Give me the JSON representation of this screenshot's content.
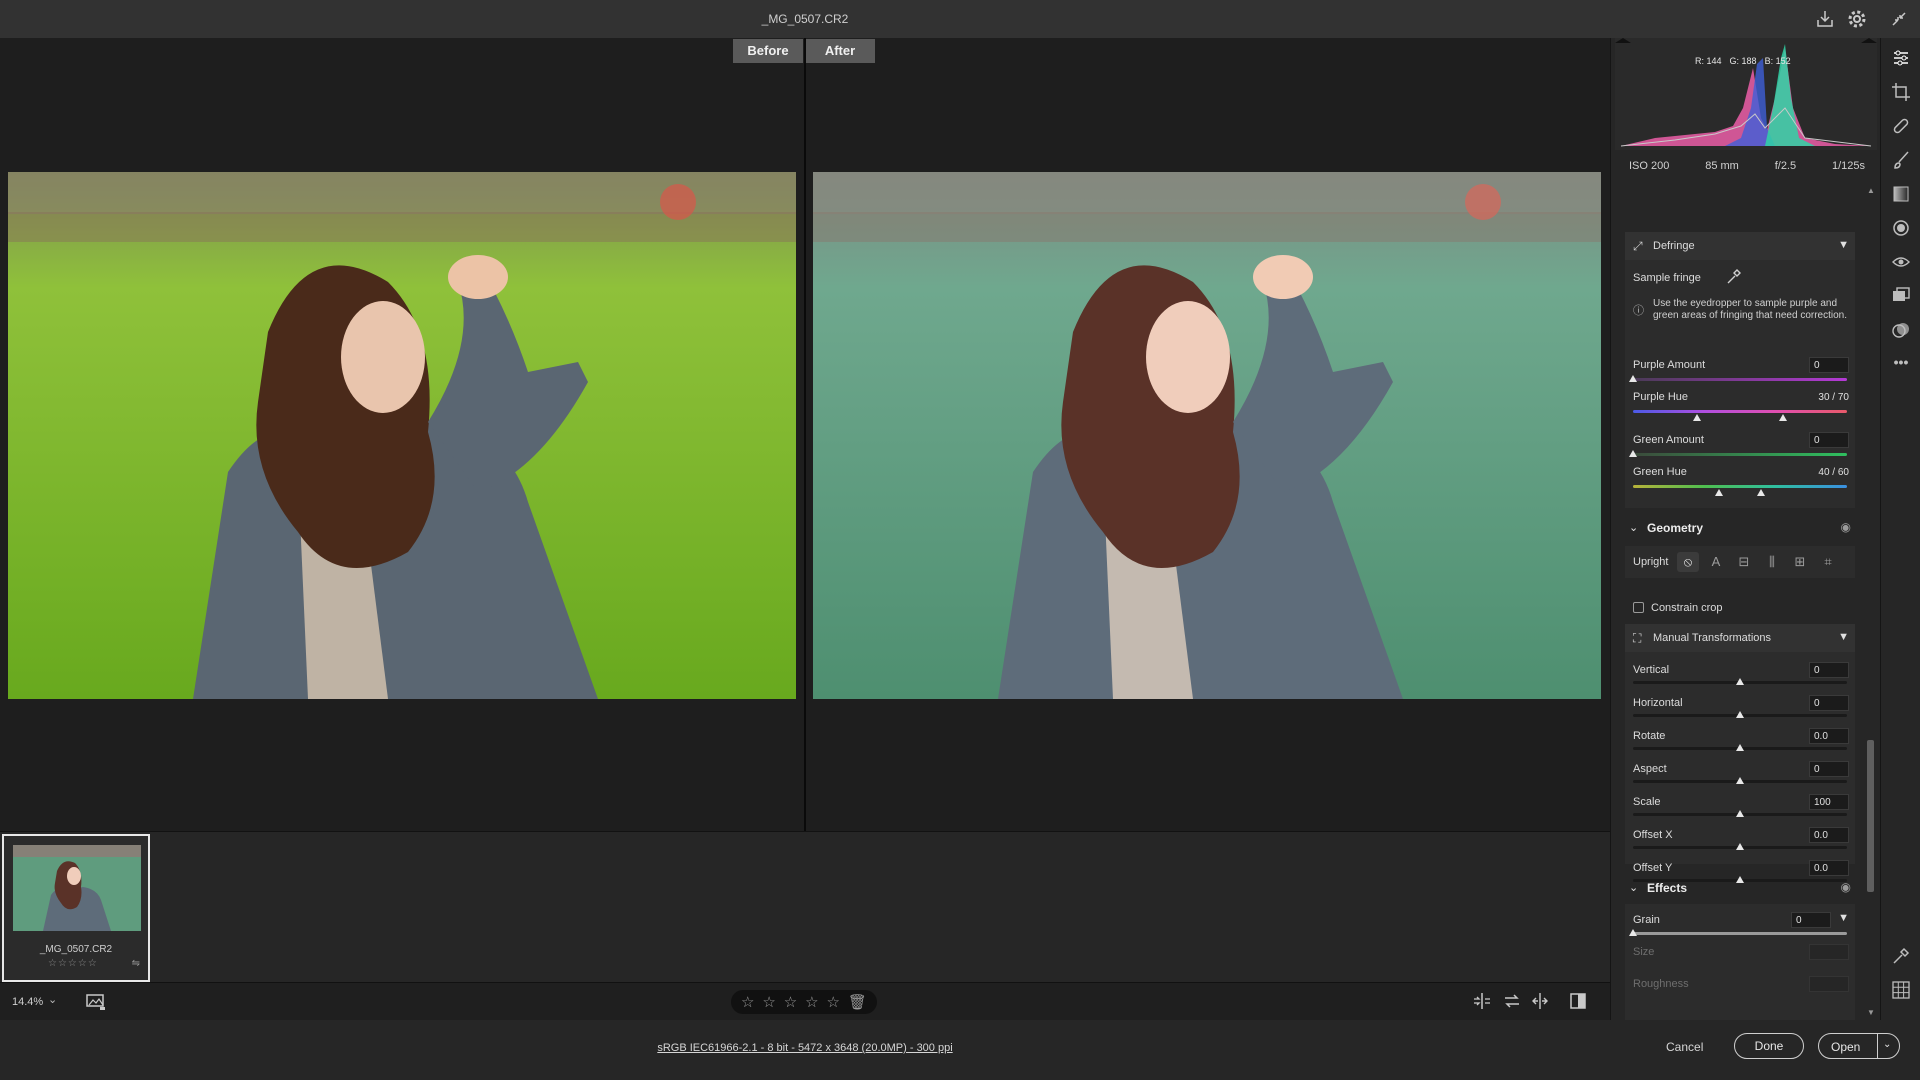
{
  "window": {
    "title": "_MG_0507.CR2"
  },
  "titlebar_icons": [
    "save-icon",
    "gear-icon",
    "fullscreen-icon"
  ],
  "viewer": {
    "tabs": {
      "before": "Before",
      "after": "After"
    }
  },
  "filmstrip": {
    "items": [
      {
        "name": "_MG_0507.CR2",
        "stars": "☆☆☆☆☆"
      }
    ]
  },
  "toolbar": {
    "zoom": "14.4%",
    "rating_stars": [
      "☆",
      "☆",
      "☆",
      "☆",
      "☆"
    ]
  },
  "status": {
    "workflow_options": "sRGB IEC61966-2.1 - 8 bit - 5472 x 3648 (20.0MP) - 300 ppi",
    "cancel": "Cancel",
    "done": "Done",
    "open": "Open"
  },
  "histogram": {
    "r": "R: 144",
    "g": "G: 188",
    "b": "B: 152"
  },
  "exif": {
    "iso": "ISO 200",
    "focal": "85 mm",
    "aperture": "f/2.5",
    "shutter": "1/125s"
  },
  "defringe": {
    "title": "Defringe",
    "sample_fringe": "Sample fringe",
    "info": "Use the eyedropper to sample purple and green areas of fringing that need correction.",
    "purple_amount": {
      "label": "Purple Amount",
      "value": "0"
    },
    "purple_hue": {
      "label": "Purple Hue",
      "value": "30 / 70",
      "low": 30,
      "high": 70
    },
    "green_amount": {
      "label": "Green Amount",
      "value": "0"
    },
    "green_hue": {
      "label": "Green Hue",
      "value": "40 / 60",
      "low": 40,
      "high": 60
    }
  },
  "geometry": {
    "title": "Geometry",
    "upright_label": "Upright",
    "constrain_crop": "Constrain crop",
    "manual_title": "Manual Transformations",
    "sliders": [
      {
        "label": "Vertical",
        "value": "0"
      },
      {
        "label": "Horizontal",
        "value": "0"
      },
      {
        "label": "Rotate",
        "value": "0.0"
      },
      {
        "label": "Aspect",
        "value": "0"
      },
      {
        "label": "Scale",
        "value": "100"
      },
      {
        "label": "Offset X",
        "value": "0.0"
      },
      {
        "label": "Offset Y",
        "value": "0.0"
      }
    ]
  },
  "effects": {
    "title": "Effects",
    "grain": {
      "label": "Grain",
      "value": "0"
    },
    "size": {
      "label": "Size"
    },
    "roughness": {
      "label": "Roughness"
    }
  },
  "side_tools": [
    "edit-icon",
    "crop-icon",
    "healing-icon",
    "brush-icon",
    "linear-gradient-icon",
    "radial-gradient-icon",
    "red-eye-icon",
    "snapshots-icon",
    "presets-icon",
    "more-icon",
    "color-sampler-icon",
    "grid-icon"
  ]
}
